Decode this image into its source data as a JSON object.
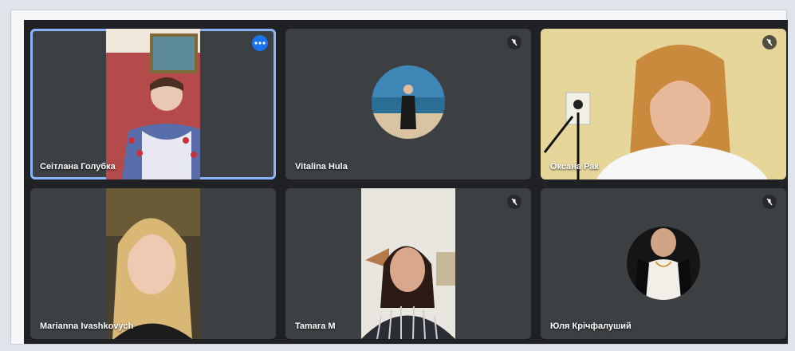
{
  "participants": [
    {
      "name": "Сеітлана Голубка",
      "icon": "more-options-icon",
      "active": true
    },
    {
      "name": "Vitalina Hula",
      "icon": "mic-off-icon"
    },
    {
      "name": "Оксана Рак",
      "icon": "mic-off-icon"
    },
    {
      "name": "Marianna Ivashkovych"
    },
    {
      "name": "Tamara M",
      "icon": "mic-off-icon"
    },
    {
      "name": "Юля Крічфалуший",
      "icon": "mic-off-icon"
    }
  ],
  "colors": {
    "tile_bg": "#3c4043",
    "stage_bg": "#202124",
    "active_border": "#8ab4f8",
    "more_button": "#1a73e8"
  }
}
